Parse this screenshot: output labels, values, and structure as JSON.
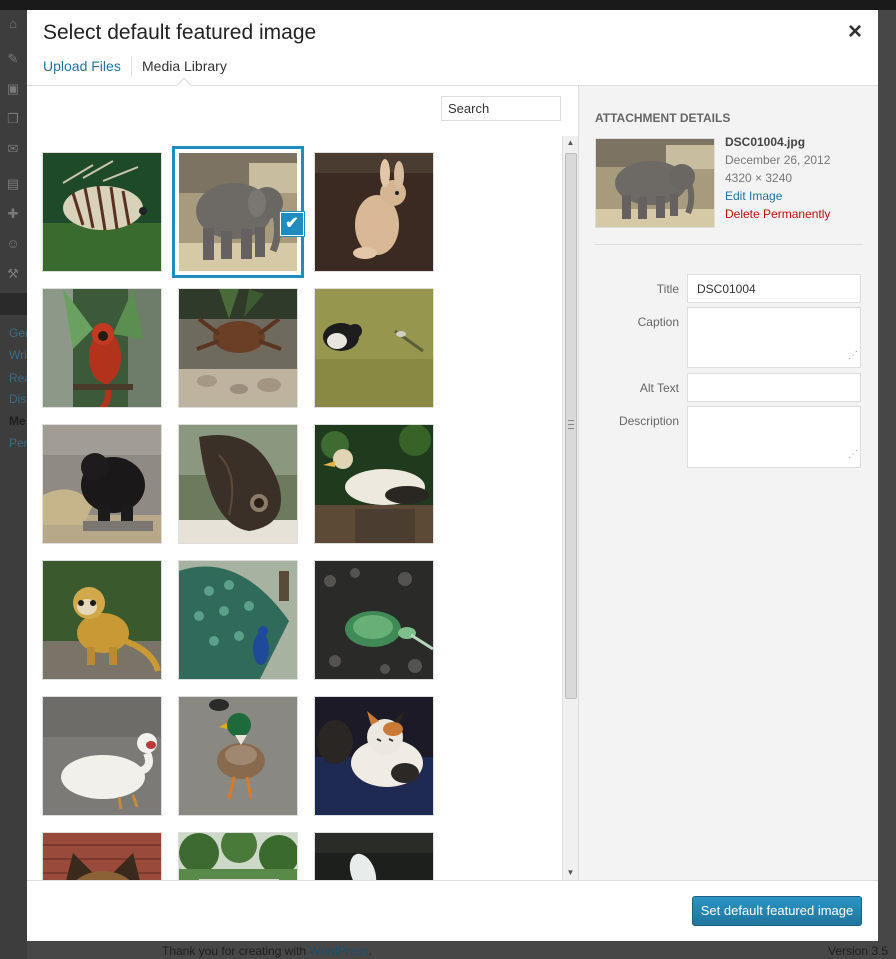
{
  "modal": {
    "title": "Select default featured image",
    "close_icon": "×",
    "tabs": [
      {
        "label": "Upload Files",
        "active": false
      },
      {
        "label": "Media Library",
        "active": true
      }
    ]
  },
  "search": {
    "placeholder": "Search"
  },
  "grid": {
    "items": [
      {
        "subject": "lionfish",
        "selected": false
      },
      {
        "subject": "elephant",
        "selected": true
      },
      {
        "subject": "rabbit",
        "selected": false
      },
      {
        "subject": "tamarin monkey",
        "selected": false
      },
      {
        "subject": "tarantula",
        "selected": false
      },
      {
        "subject": "penguin",
        "selected": false
      },
      {
        "subject": "bear",
        "selected": false
      },
      {
        "subject": "butterfly",
        "selected": false
      },
      {
        "subject": "vulture",
        "selected": false
      },
      {
        "subject": "squirrel monkey",
        "selected": false
      },
      {
        "subject": "peacock",
        "selected": false
      },
      {
        "subject": "turtle",
        "selected": false
      },
      {
        "subject": "white duck",
        "selected": false
      },
      {
        "subject": "mallard duck",
        "selected": false
      },
      {
        "subject": "cats",
        "selected": false
      },
      {
        "subject": "german shepherd",
        "selected": false
      },
      {
        "subject": "park",
        "selected": false
      },
      {
        "subject": "white bird",
        "selected": false
      }
    ],
    "check_icon": "✔"
  },
  "details": {
    "heading": "Attachment Details",
    "filename": "DSC01004.jpg",
    "date": "December 26, 2012",
    "dimensions": "4320 × 3240",
    "edit_link": "Edit Image",
    "delete_link": "Delete Permanently",
    "fields": {
      "title_label": "Title",
      "title_value": "DSC01004",
      "caption_label": "Caption",
      "caption_value": "",
      "alt_label": "Alt Text",
      "alt_value": "",
      "description_label": "Description",
      "description_value": ""
    }
  },
  "footer": {
    "button_label": "Set default featured image"
  },
  "background": {
    "sidebar_items": [
      "Gen",
      "Wri",
      "Rea",
      "Dis",
      "Me",
      "Per"
    ],
    "footer_text": "Thank you for creating with",
    "footer_link": "WordPress",
    "footer_end": ".",
    "version": "Version 3.5"
  },
  "colors": {
    "accent": "#21759b",
    "selected_border": "#1e8cbe",
    "danger": "#bc0b0b"
  }
}
